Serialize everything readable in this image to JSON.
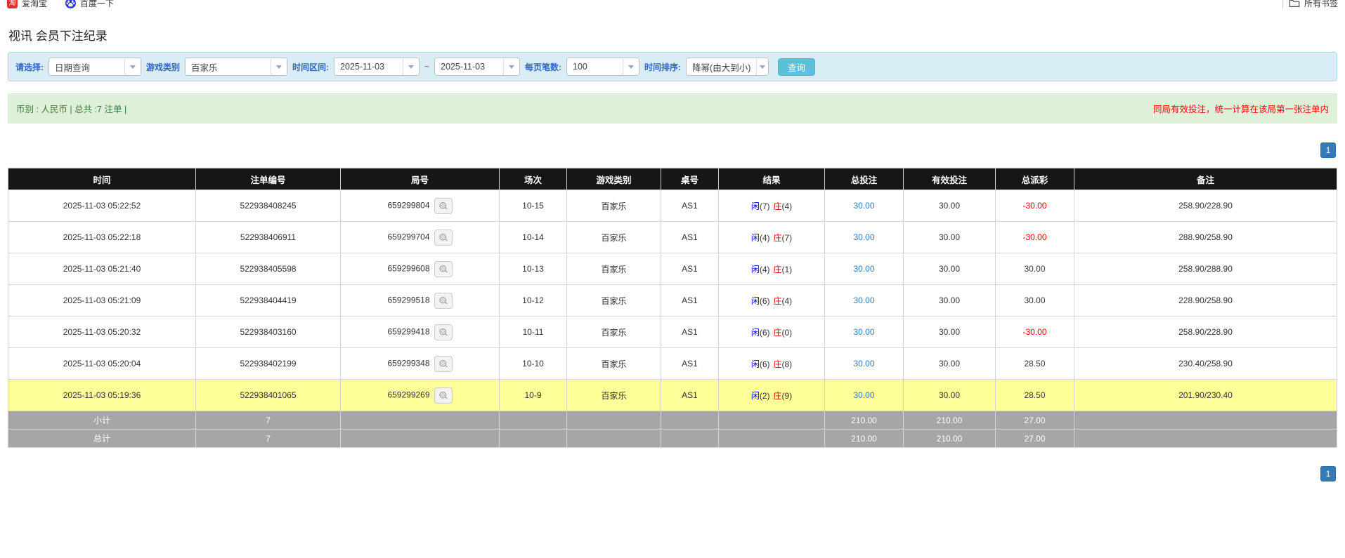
{
  "bookmarks": {
    "items": [
      {
        "label": "爱淘宝",
        "icon": "taobao-icon",
        "badge_glyph": "淘"
      },
      {
        "label": "百度一下",
        "icon": "baidu-icon"
      }
    ],
    "all_bookmarks_label": "所有书签"
  },
  "page": {
    "title": "视讯 会员下注纪录"
  },
  "filters": {
    "select_label": "请选择:",
    "select_value": "日期查询",
    "game_type_label": "游戏类别",
    "game_type_value": "百家乐",
    "time_range_label": "时间区间:",
    "date_from": "2025-11-03",
    "range_separator": "~",
    "date_to": "2025-11-03",
    "page_size_label": "每页笔数:",
    "page_size_value": "100",
    "sort_label": "时间排序:",
    "sort_value": "降幂(由大到小)",
    "query_button_label": "查询"
  },
  "summary": {
    "left_text": "币别 : 人民币 | 总共 :7 注单 |",
    "right_text": "同局有效投注，统一计算在该局第一张注单内"
  },
  "pagination": {
    "page_label": "1"
  },
  "table": {
    "headers": [
      "时间",
      "注单编号",
      "局号",
      "场次",
      "游戏类别",
      "桌号",
      "结果",
      "总投注",
      "有效投注",
      "总派彩",
      "备注"
    ],
    "rows": [
      {
        "time": "2025-11-03 05:22:52",
        "bet_id": "522938408245",
        "round_id": "659299804",
        "session": "10-15",
        "game": "百家乐",
        "table_no": "AS1",
        "result": {
          "player_label": "闲",
          "player_value": "(7)",
          "banker_label": "庄",
          "banker_value": "(4)"
        },
        "total_bet": "30.00",
        "valid_bet": "30.00",
        "payout": "-30.00",
        "remark": "258.90/228.90",
        "highlight": false
      },
      {
        "time": "2025-11-03 05:22:18",
        "bet_id": "522938406911",
        "round_id": "659299704",
        "session": "10-14",
        "game": "百家乐",
        "table_no": "AS1",
        "result": {
          "player_label": "闲",
          "player_value": "(4)",
          "banker_label": "庄",
          "banker_value": "(7)"
        },
        "total_bet": "30.00",
        "valid_bet": "30.00",
        "payout": "-30.00",
        "remark": "288.90/258.90",
        "highlight": false
      },
      {
        "time": "2025-11-03 05:21:40",
        "bet_id": "522938405598",
        "round_id": "659299608",
        "session": "10-13",
        "game": "百家乐",
        "table_no": "AS1",
        "result": {
          "player_label": "闲",
          "player_value": "(4)",
          "banker_label": "庄",
          "banker_value": "(1)"
        },
        "total_bet": "30.00",
        "valid_bet": "30.00",
        "payout": "30.00",
        "remark": "258.90/288.90",
        "highlight": false
      },
      {
        "time": "2025-11-03 05:21:09",
        "bet_id": "522938404419",
        "round_id": "659299518",
        "session": "10-12",
        "game": "百家乐",
        "table_no": "AS1",
        "result": {
          "player_label": "闲",
          "player_value": "(6)",
          "banker_label": "庄",
          "banker_value": "(4)"
        },
        "total_bet": "30.00",
        "valid_bet": "30.00",
        "payout": "30.00",
        "remark": "228.90/258.90",
        "highlight": false
      },
      {
        "time": "2025-11-03 05:20:32",
        "bet_id": "522938403160",
        "round_id": "659299418",
        "session": "10-11",
        "game": "百家乐",
        "table_no": "AS1",
        "result": {
          "player_label": "闲",
          "player_value": "(6)",
          "banker_label": "庄",
          "banker_value": "(0)"
        },
        "total_bet": "30.00",
        "valid_bet": "30.00",
        "payout": "-30.00",
        "remark": "258.90/228.90",
        "highlight": false
      },
      {
        "time": "2025-11-03 05:20:04",
        "bet_id": "522938402199",
        "round_id": "659299348",
        "session": "10-10",
        "game": "百家乐",
        "table_no": "AS1",
        "result": {
          "player_label": "闲",
          "player_value": "(6)",
          "banker_label": "庄",
          "banker_value": "(8)"
        },
        "total_bet": "30.00",
        "valid_bet": "30.00",
        "payout": "28.50",
        "remark": "230.40/258.90",
        "highlight": false
      },
      {
        "time": "2025-11-03 05:19:36",
        "bet_id": "522938401065",
        "round_id": "659299269",
        "session": "10-9",
        "game": "百家乐",
        "table_no": "AS1",
        "result": {
          "player_label": "闲",
          "player_value": "(2)",
          "banker_label": "庄",
          "banker_value": "(9)"
        },
        "total_bet": "30.00",
        "valid_bet": "30.00",
        "payout": "28.50",
        "remark": "201.90/230.40",
        "highlight": true
      }
    ],
    "summary_rows": [
      {
        "label": "小计",
        "count": "7",
        "round_id": "",
        "session": "",
        "game": "",
        "table_no": "",
        "result": "",
        "total_bet": "210.00",
        "valid_bet": "210.00",
        "payout": "27.00",
        "remark": ""
      },
      {
        "label": "总计",
        "count": "7",
        "round_id": "",
        "session": "",
        "game": "",
        "table_no": "",
        "result": "",
        "total_bet": "210.00",
        "valid_bet": "210.00",
        "payout": "27.00",
        "remark": ""
      }
    ]
  },
  "colors": {
    "filter_panel_bg": "#d9edf7",
    "filter_label": "#3366bb",
    "query_button": "#5bc0de",
    "summary_bar_bg": "#dff0d8",
    "summary_text": "#3c763d",
    "warning_text": "#ff0000",
    "header_bg": "#161616",
    "highlight_row": "#ffff99",
    "summary_row_bg": "#a6a6a6",
    "link_blue": "#337ab7",
    "player_blue": "#0000ee",
    "banker_red": "#ee0000"
  }
}
